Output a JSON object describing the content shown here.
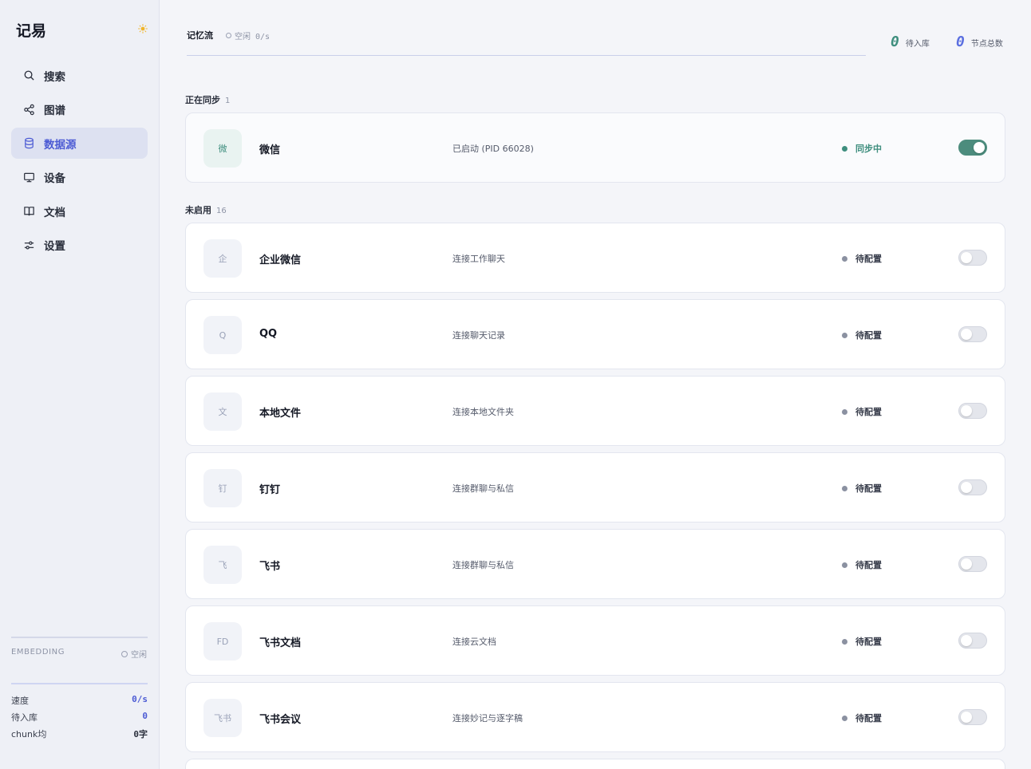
{
  "app": {
    "title": "记易"
  },
  "nav": [
    {
      "label": "搜索",
      "icon": "search-icon"
    },
    {
      "label": "图谱",
      "icon": "share-icon"
    },
    {
      "label": "数据源",
      "icon": "database-icon",
      "active": true
    },
    {
      "label": "设备",
      "icon": "monitor-icon"
    },
    {
      "label": "文档",
      "icon": "book-icon"
    },
    {
      "label": "设置",
      "icon": "sliders-icon"
    }
  ],
  "embedding": {
    "label": "EMBEDDING",
    "status": "空闲",
    "stats": [
      {
        "label": "速度",
        "value": "0/s"
      },
      {
        "label": "待入库",
        "value": "0"
      },
      {
        "label": "chunk均",
        "value": "0字"
      }
    ]
  },
  "header": {
    "title": "记忆流",
    "status": "空闲 0/s",
    "pending_count": "0",
    "pending_label": "待入库",
    "nodes_count": "0",
    "nodes_label": "节点总数"
  },
  "colors": {
    "accent": "#4c5bd4",
    "active_green": "#3e8e7e",
    "pending_count": "#3e8e7e",
    "nodes_count": "#5b6fe0"
  },
  "syncing": {
    "label": "正在同步",
    "count": "1",
    "items": [
      {
        "badge": "微",
        "name": "微信",
        "desc": "已启动 (PID 66028)",
        "status": "同步中",
        "enabled": true
      }
    ]
  },
  "disabled": {
    "label": "未启用",
    "count": "16",
    "items": [
      {
        "badge": "企",
        "name": "企业微信",
        "desc": "连接工作聊天",
        "status": "待配置",
        "enabled": false
      },
      {
        "badge": "Q",
        "name": "QQ",
        "desc": "连接聊天记录",
        "status": "待配置",
        "enabled": false
      },
      {
        "badge": "文",
        "name": "本地文件",
        "desc": "连接本地文件夹",
        "status": "待配置",
        "enabled": false
      },
      {
        "badge": "钉",
        "name": "钉钉",
        "desc": "连接群聊与私信",
        "status": "待配置",
        "enabled": false
      },
      {
        "badge": "飞",
        "name": "飞书",
        "desc": "连接群聊与私信",
        "status": "待配置",
        "enabled": false
      },
      {
        "badge": "FD",
        "name": "飞书文档",
        "desc": "连接云文档",
        "status": "待配置",
        "enabled": false
      },
      {
        "badge": "飞书",
        "name": "飞书会议",
        "desc": "连接妙记与逐字稿",
        "status": "待配置",
        "enabled": false
      }
    ]
  }
}
